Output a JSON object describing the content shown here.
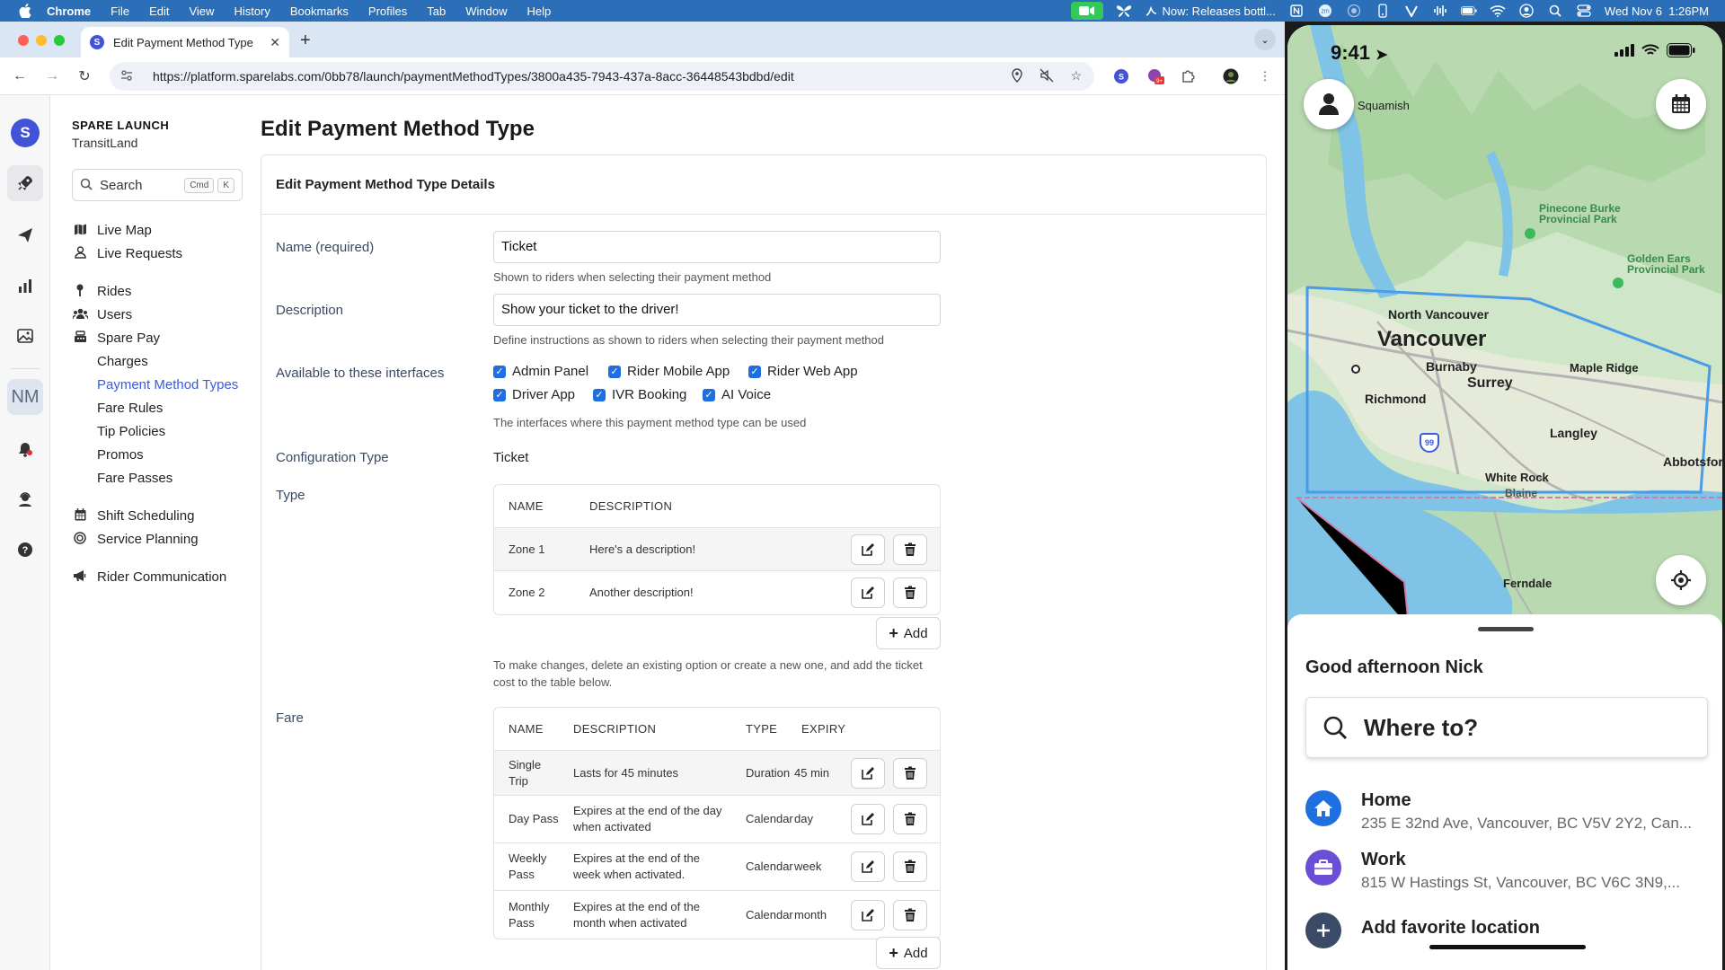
{
  "menubar": {
    "app": "Chrome",
    "items": [
      "File",
      "Edit",
      "View",
      "History",
      "Bookmarks",
      "Profiles",
      "Tab",
      "Window",
      "Help"
    ],
    "now_playing": "Now: Releases bottl...",
    "datetime": "Wed Nov 6  1:26PM"
  },
  "browser": {
    "tab_title": "Edit Payment Method Type",
    "tab_favicon": "S",
    "url": "https://platform.sparelabs.com/0bb78/launch/paymentMethodTypes/3800a435-7943-437a-8acc-36448543bdbd/edit"
  },
  "rail": {
    "avatar": "S",
    "nm": "NM"
  },
  "sidebar": {
    "org_name": "SPARE LAUNCH",
    "org_sub": "TransitLand",
    "search_placeholder": "Search",
    "kbd_cmd": "Cmd",
    "kbd_k": "K",
    "items": {
      "live_map": "Live Map",
      "live_requests": "Live Requests",
      "rides": "Rides",
      "users": "Users",
      "spare_pay": "Spare Pay",
      "charges": "Charges",
      "payment_method_types": "Payment Method Types",
      "fare_rules": "Fare Rules",
      "tip_policies": "Tip Policies",
      "promos": "Promos",
      "fare_passes": "Fare Passes",
      "shift_scheduling": "Shift Scheduling",
      "service_planning": "Service Planning",
      "rider_communication": "Rider Communication"
    }
  },
  "main": {
    "page_title": "Edit Payment Method Type",
    "card_title": "Edit Payment Method Type Details",
    "name": {
      "label": "Name (required)",
      "value": "Ticket",
      "help": "Shown to riders when selecting their payment method"
    },
    "description": {
      "label": "Description",
      "value": "Show your ticket to the driver!",
      "help": "Define instructions as shown to riders when selecting their payment method"
    },
    "interfaces": {
      "label": "Available to these interfaces",
      "options": [
        "Admin Panel",
        "Rider Mobile App",
        "Rider Web App",
        "Driver App",
        "IVR Booking",
        "AI Voice"
      ],
      "help": "The interfaces where this payment method type can be used"
    },
    "config": {
      "label": "Configuration Type",
      "value": "Ticket"
    },
    "type_table": {
      "label": "Type",
      "headers": [
        "NAME",
        "DESCRIPTION"
      ],
      "rows": [
        {
          "name": "Zone 1",
          "description": "Here's a description!"
        },
        {
          "name": "Zone 2",
          "description": "Another description!"
        }
      ],
      "add_label": "Add",
      "help": "To make changes, delete an existing option or create a new one, and add the ticket cost to the table below."
    },
    "fare_table": {
      "label": "Fare",
      "headers": [
        "NAME",
        "DESCRIPTION",
        "TYPE",
        "EXPIRY"
      ],
      "rows": [
        {
          "name": "Single Trip",
          "description": "Lasts for 45 minutes",
          "type": "Duration",
          "expiry": "45 min"
        },
        {
          "name": "Day Pass",
          "description": "Expires at the end of the day when activated",
          "type": "Calendar",
          "expiry": "day"
        },
        {
          "name": "Weekly Pass",
          "description": "Expires at the end of the week when activated.",
          "type": "Calendar",
          "expiry": "week"
        },
        {
          "name": "Monthly Pass",
          "description": "Expires at the end of the month when activated",
          "type": "Calendar",
          "expiry": "month"
        }
      ],
      "add_label": "Add"
    }
  },
  "phone": {
    "time": "9:41",
    "map_labels": {
      "squamish": "Squamish",
      "pinecone": "Pinecone Burke Provincial Park",
      "golden_ears": "Golden Ears Provincial Park",
      "north_vancouver": "North Vancouver",
      "vancouver": "Vancouver",
      "burnaby": "Burnaby",
      "maple_ridge": "Maple Ridge",
      "surrey": "Surrey",
      "richmond": "Richmond",
      "langley": "Langley",
      "abbotsford": "Abbotsfor",
      "white_rock": "White Rock",
      "blaine": "Blaine",
      "ferndale": "Ferndale",
      "hwy": "99"
    },
    "greeting": "Good afternoon Nick",
    "where_to": "Where to?",
    "favorites": [
      {
        "title": "Home",
        "address": "235 E 32nd Ave, Vancouver, BC V5V 2Y2, Can..."
      },
      {
        "title": "Work",
        "address": "815 W Hastings St, Vancouver, BC V6C 3N9,..."
      }
    ],
    "add_favorite": "Add favorite location"
  },
  "colors": {
    "menubar": "#2b6fb8",
    "accent": "#3b5bdb",
    "checkbox": "#1f6fe0",
    "home_icon": "#1f6fe0",
    "work_icon": "#6a4fd6",
    "zone_line": "#4a9be8"
  }
}
